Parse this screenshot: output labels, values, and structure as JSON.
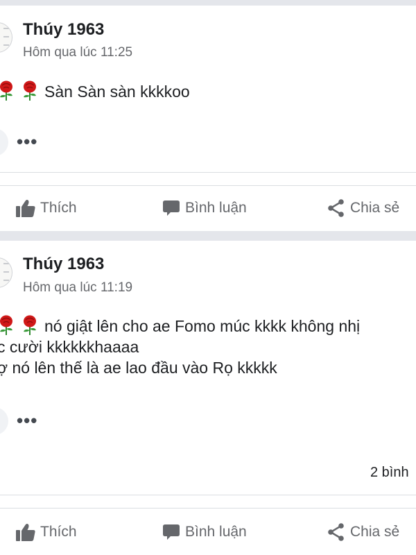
{
  "posts": [
    {
      "author": "Thúy 1963",
      "timestamp": "Hôm qua lúc 11:25",
      "lines": [
        "Sàn Sàn sàn kkkkoo"
      ],
      "more": "•••",
      "comment_count": "",
      "actions": {
        "like": "Thích",
        "comment": "Bình luận",
        "share": "Chia sẻ"
      }
    },
    {
      "author": "Thúy 1963",
      "timestamp": "Hôm qua lúc 11:19",
      "lines": [
        "nó giật lên cho ae Fomo múc kkkk không nhị",
        "c cười kkkkkkhaaaa",
        "ợ nó lên thế là ae lao đầu vào Rọ kkkkk"
      ],
      "more": "•••",
      "comment_count": "2 bình",
      "actions": {
        "like": "Thích",
        "comment": "Bình luận",
        "share": "Chia sẻ"
      }
    }
  ],
  "icons": {
    "like": "thumbs-up-icon",
    "comment": "speech-bubble-icon",
    "share": "share-icon",
    "rose": "rose-emoji"
  },
  "colors": {
    "text": "#1c1e21",
    "secondary": "#65676b",
    "separator": "#e4e6eb",
    "rose": "#d01818"
  }
}
